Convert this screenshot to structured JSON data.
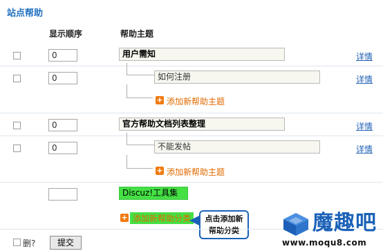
{
  "section_title": "站点帮助",
  "columns": {
    "order": "显示顺序",
    "topic": "帮助主题"
  },
  "rows": [
    {
      "order": "0",
      "topic": "用户需知",
      "detail": "详情"
    },
    {
      "order": "0",
      "topic": "如何注册",
      "detail": "详情"
    },
    {
      "order": "0",
      "topic": "官方帮助文档列表整理",
      "detail": "详情"
    },
    {
      "order": "0",
      "topic": "不能发帖",
      "detail": "详情"
    }
  ],
  "add_topic_label": "添加新帮助主题",
  "new_category": {
    "order": "",
    "topic": "Discuz!工具集合"
  },
  "add_category_label": "添加新帮助分类",
  "callout": {
    "line1": "点击添加新",
    "line2": "帮助分类"
  },
  "footer": {
    "delete_label": "删?",
    "submit_label": "提交"
  },
  "logo": {
    "text": "魔趣吧",
    "url": "www.moqu8.com"
  },
  "colors": {
    "title_blue": "#1f6fc0",
    "link_blue": "#1f5fb4",
    "add_orange": "#e06a00",
    "highlight_green": "#44e044",
    "callout_border": "#1b62b8"
  }
}
